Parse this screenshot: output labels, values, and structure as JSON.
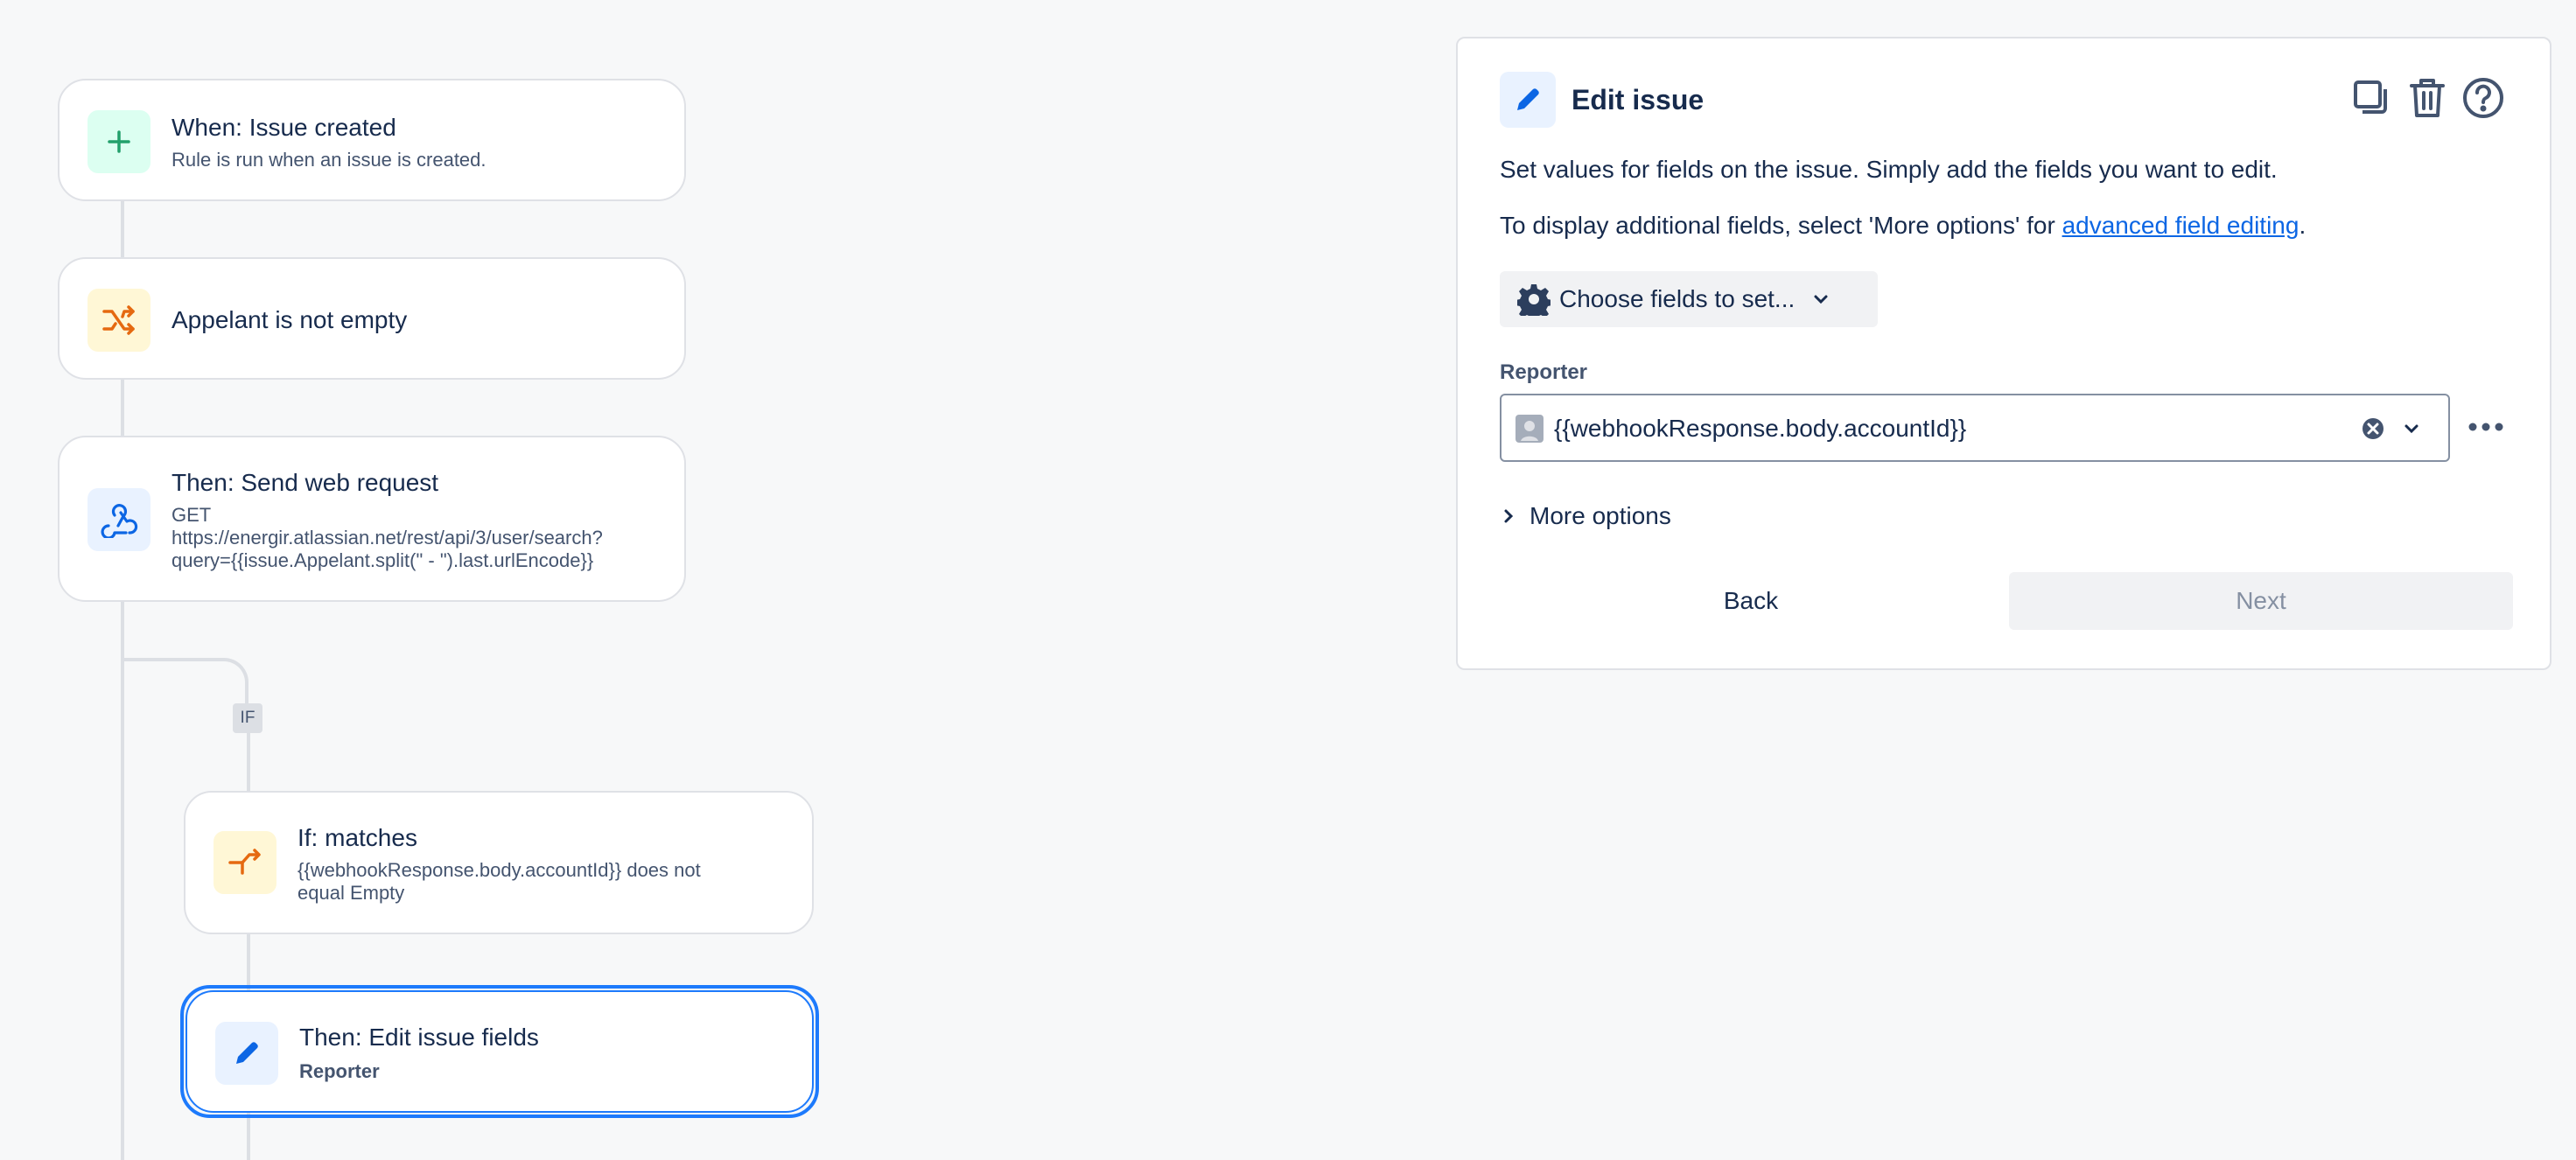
{
  "flow": {
    "trigger": {
      "title": "When: Issue created",
      "subtitle": "Rule is run when an issue is created."
    },
    "condition": {
      "title": "Appelant is not empty"
    },
    "web_request": {
      "title": "Then: Send web request",
      "line1": "GET",
      "line2": "https://energir.atlassian.net/rest/api/3/user/search?",
      "line3": "query={{issue.Appelant.split(\" - \").last.urlEncode}}"
    },
    "if_badge": "IF",
    "if_match": {
      "title": "If: matches",
      "line1": "{{webhookResponse.body.accountId}} does not",
      "line2": "equal Empty"
    },
    "edit_fields": {
      "title": "Then: Edit issue fields",
      "subtitle": "Reporter"
    }
  },
  "panel": {
    "title": "Edit issue",
    "description": "Set values for fields on the issue. Simply add the fields you want to edit.",
    "additional_prefix": "To display additional fields, select 'More options' for ",
    "additional_link": "advanced field editing",
    "additional_suffix": ".",
    "choose_fields": "Choose fields to set...",
    "reporter_label": "Reporter",
    "reporter_value": "{{webhookResponse.body.accountId}}",
    "more_options": "More options",
    "back": "Back",
    "next": "Next"
  },
  "colors": {
    "accent": "#1d7afc",
    "link": "#0c66e4",
    "green_icon": "#22a06b",
    "orange_icon": "#e56910",
    "blue_icon": "#0c66e4"
  }
}
